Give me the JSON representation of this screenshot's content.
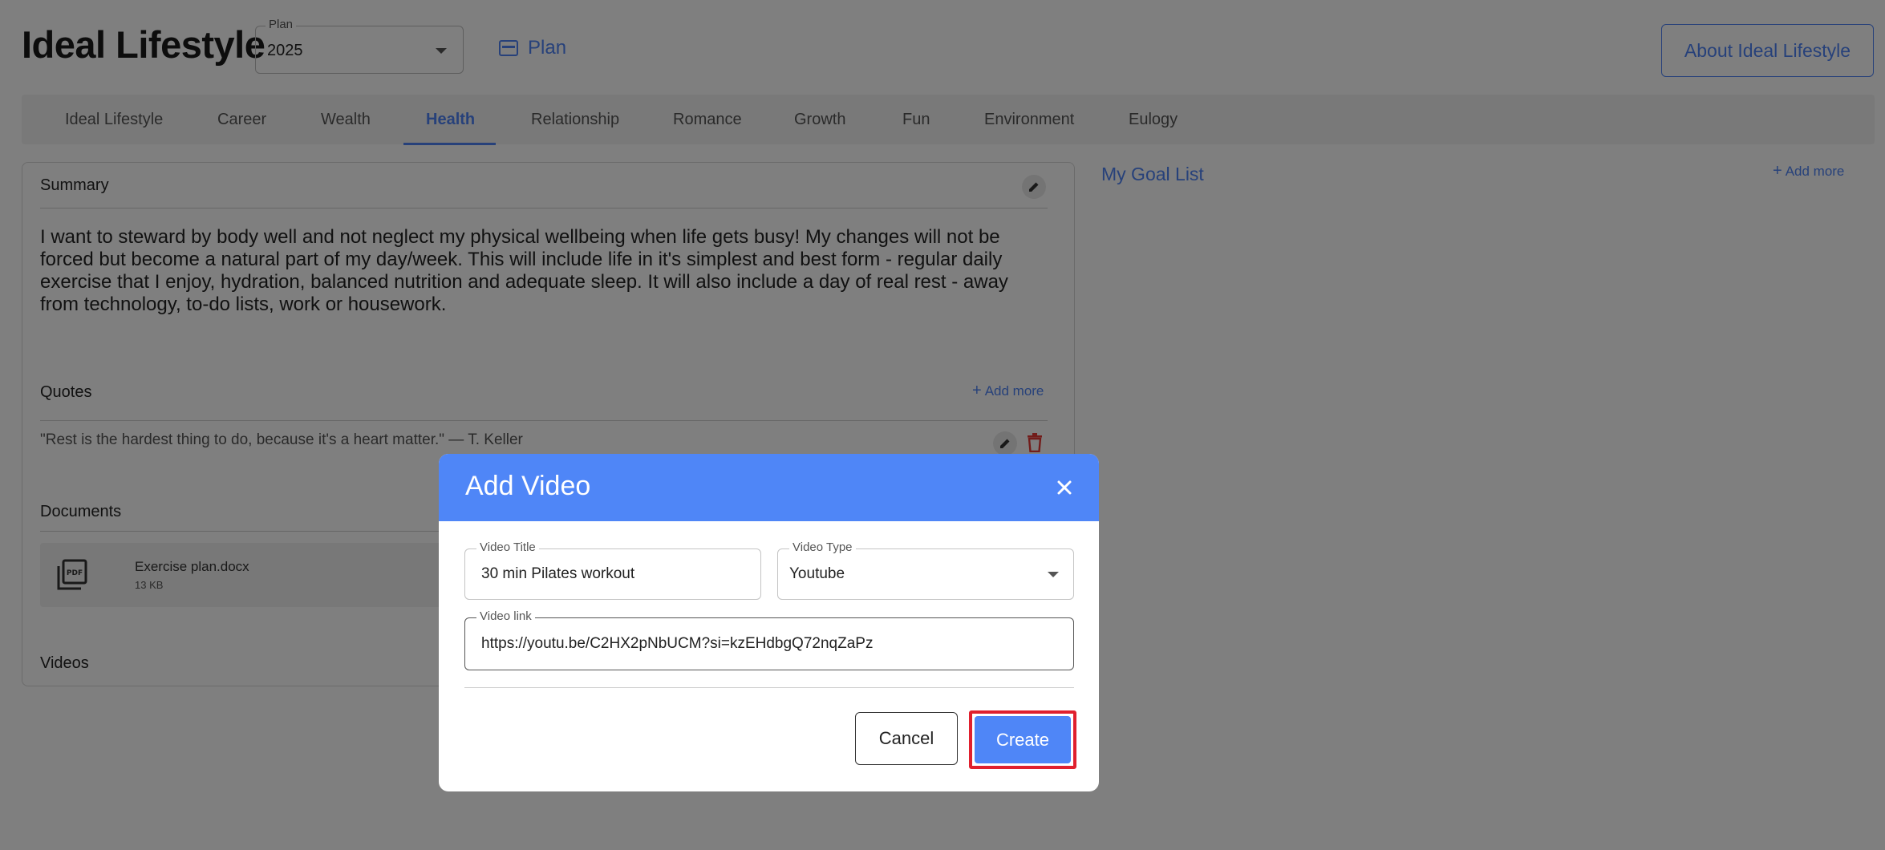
{
  "header": {
    "title": "Ideal Lifestyle",
    "plan_label": "Plan",
    "plan_value": "2025",
    "plan_link": "Plan",
    "about_button": "About Ideal Lifestyle"
  },
  "tabs": [
    {
      "label": "Ideal Lifestyle"
    },
    {
      "label": "Career"
    },
    {
      "label": "Wealth"
    },
    {
      "label": "Health",
      "active": true
    },
    {
      "label": "Relationship"
    },
    {
      "label": "Romance"
    },
    {
      "label": "Growth"
    },
    {
      "label": "Fun"
    },
    {
      "label": "Environment"
    },
    {
      "label": "Eulogy"
    }
  ],
  "summary": {
    "label": "Summary",
    "text": "I want to steward by body well and not neglect my physical wellbeing when life gets busy! My changes will not be forced but become a natural part of my day/week. This will include life in it's simplest and best form - regular daily exercise that I enjoy, hydration, balanced nutrition and adequate sleep. It will also include a day of real rest - away from technology, to-do lists, work or housework."
  },
  "quotes": {
    "label": "Quotes",
    "add_more": "Add more",
    "items": [
      "\"Rest is the hardest thing to do, because it's a heart matter.\" — T. Keller"
    ]
  },
  "documents": {
    "label": "Documents",
    "items": [
      {
        "name": "Exercise plan.docx",
        "size": "13 KB"
      }
    ]
  },
  "videos": {
    "label": "Videos"
  },
  "goals": {
    "title": "My Goal List",
    "add_more": "Add more"
  },
  "modal": {
    "title": "Add Video",
    "video_title_label": "Video Title",
    "video_title_value": "30 min Pilates workout",
    "video_type_label": "Video Type",
    "video_type_value": "Youtube",
    "video_link_label": "Video link",
    "video_link_value": "https://youtu.be/C2HX2pNbUCM?si=kzEHdbgQ72nqZaPz",
    "cancel_label": "Cancel",
    "create_label": "Create"
  },
  "colors": {
    "accent": "#4f86f7",
    "highlight": "#e0202e",
    "delete": "#e53935"
  }
}
